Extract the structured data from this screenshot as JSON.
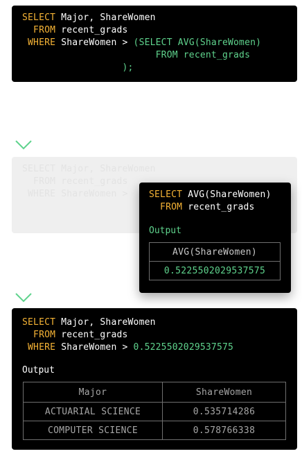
{
  "panel1": {
    "line1": {
      "kw": "SELECT",
      "rest": " Major, ShareWomen"
    },
    "line2": {
      "kw": "  FROM",
      "rest": " recent_grads"
    },
    "line3": {
      "kw": " WHERE",
      "rest": " ShareWomen > ",
      "sub": "(SELECT AVG(ShareWomen)"
    },
    "line4": {
      "sub": "                        FROM recent_grads"
    },
    "line5": {
      "sub": "                  );"
    }
  },
  "faded": {
    "line1": {
      "kw": "SELECT",
      "rest": " Major, ShareWomen"
    },
    "line2": {
      "kw": "  FROM",
      "rest": " recent_grads"
    },
    "line3": {
      "kw": " WHERE",
      "rest": " ShareWomen >"
    }
  },
  "panel2": {
    "line1": {
      "kw": "SELECT",
      "rest": " AVG(ShareWomen)"
    },
    "line2": {
      "kw": "  FROM",
      "rest": " recent_grads"
    },
    "output_label": "Output",
    "table": {
      "header": "AVG(ShareWomen)",
      "value": "0.5225502029537575"
    }
  },
  "panel3": {
    "line1": {
      "kw": "SELECT",
      "rest": " Major, ShareWomen"
    },
    "line2": {
      "kw": "  FROM",
      "rest": " recent_grads"
    },
    "line3": {
      "kw": " WHERE",
      "rest": " ShareWomen > ",
      "num": "0.5225502029537575"
    },
    "output_label": "Output",
    "table": {
      "headers": [
        "Major",
        "ShareWomen"
      ],
      "rows": [
        [
          "ACTUARIAL SCIENCE",
          "0.535714286"
        ],
        [
          "COMPUTER SCIENCE",
          "0.578766338"
        ]
      ]
    }
  },
  "colors": {
    "keyword": "#f5b335",
    "highlight": "#5fd38d",
    "panel": "#000000",
    "arrow": "#5fd38d"
  }
}
